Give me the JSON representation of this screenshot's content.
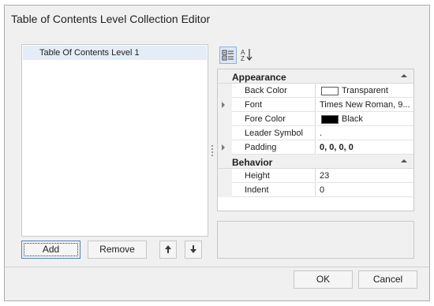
{
  "window": {
    "title": "Table of Contents Level Collection Editor"
  },
  "list": {
    "items": [
      {
        "label": "Table Of Contents Level 1"
      }
    ]
  },
  "buttons": {
    "add": "Add",
    "remove": "Remove",
    "move_up_icon": "arrow-up-icon",
    "move_down_icon": "arrow-down-icon",
    "ok": "OK",
    "cancel": "Cancel"
  },
  "property_grid": {
    "toolbar": [
      {
        "icon": "categorized-icon",
        "active": true
      },
      {
        "icon": "alphabetical-sort-icon",
        "active": false
      }
    ],
    "categories": [
      {
        "name": "Appearance",
        "properties": [
          {
            "name": "Back Color",
            "value": "Transparent",
            "swatch": "#ffffff"
          },
          {
            "name": "Font",
            "value": "Times New Roman, 9...",
            "expandable": true
          },
          {
            "name": "Fore Color",
            "value": "Black",
            "swatch": "#000000"
          },
          {
            "name": "Leader Symbol",
            "value": "."
          },
          {
            "name": "Padding",
            "value": "0, 0, 0, 0",
            "expandable": true,
            "bold": true
          }
        ]
      },
      {
        "name": "Behavior",
        "properties": [
          {
            "name": "Height",
            "value": "23"
          },
          {
            "name": "Indent",
            "value": "0"
          }
        ]
      }
    ]
  },
  "colors": {
    "accent_border": "#4a7fc0",
    "selection": "#e4ecf7",
    "dialog_bg": "#f0f0f0"
  }
}
